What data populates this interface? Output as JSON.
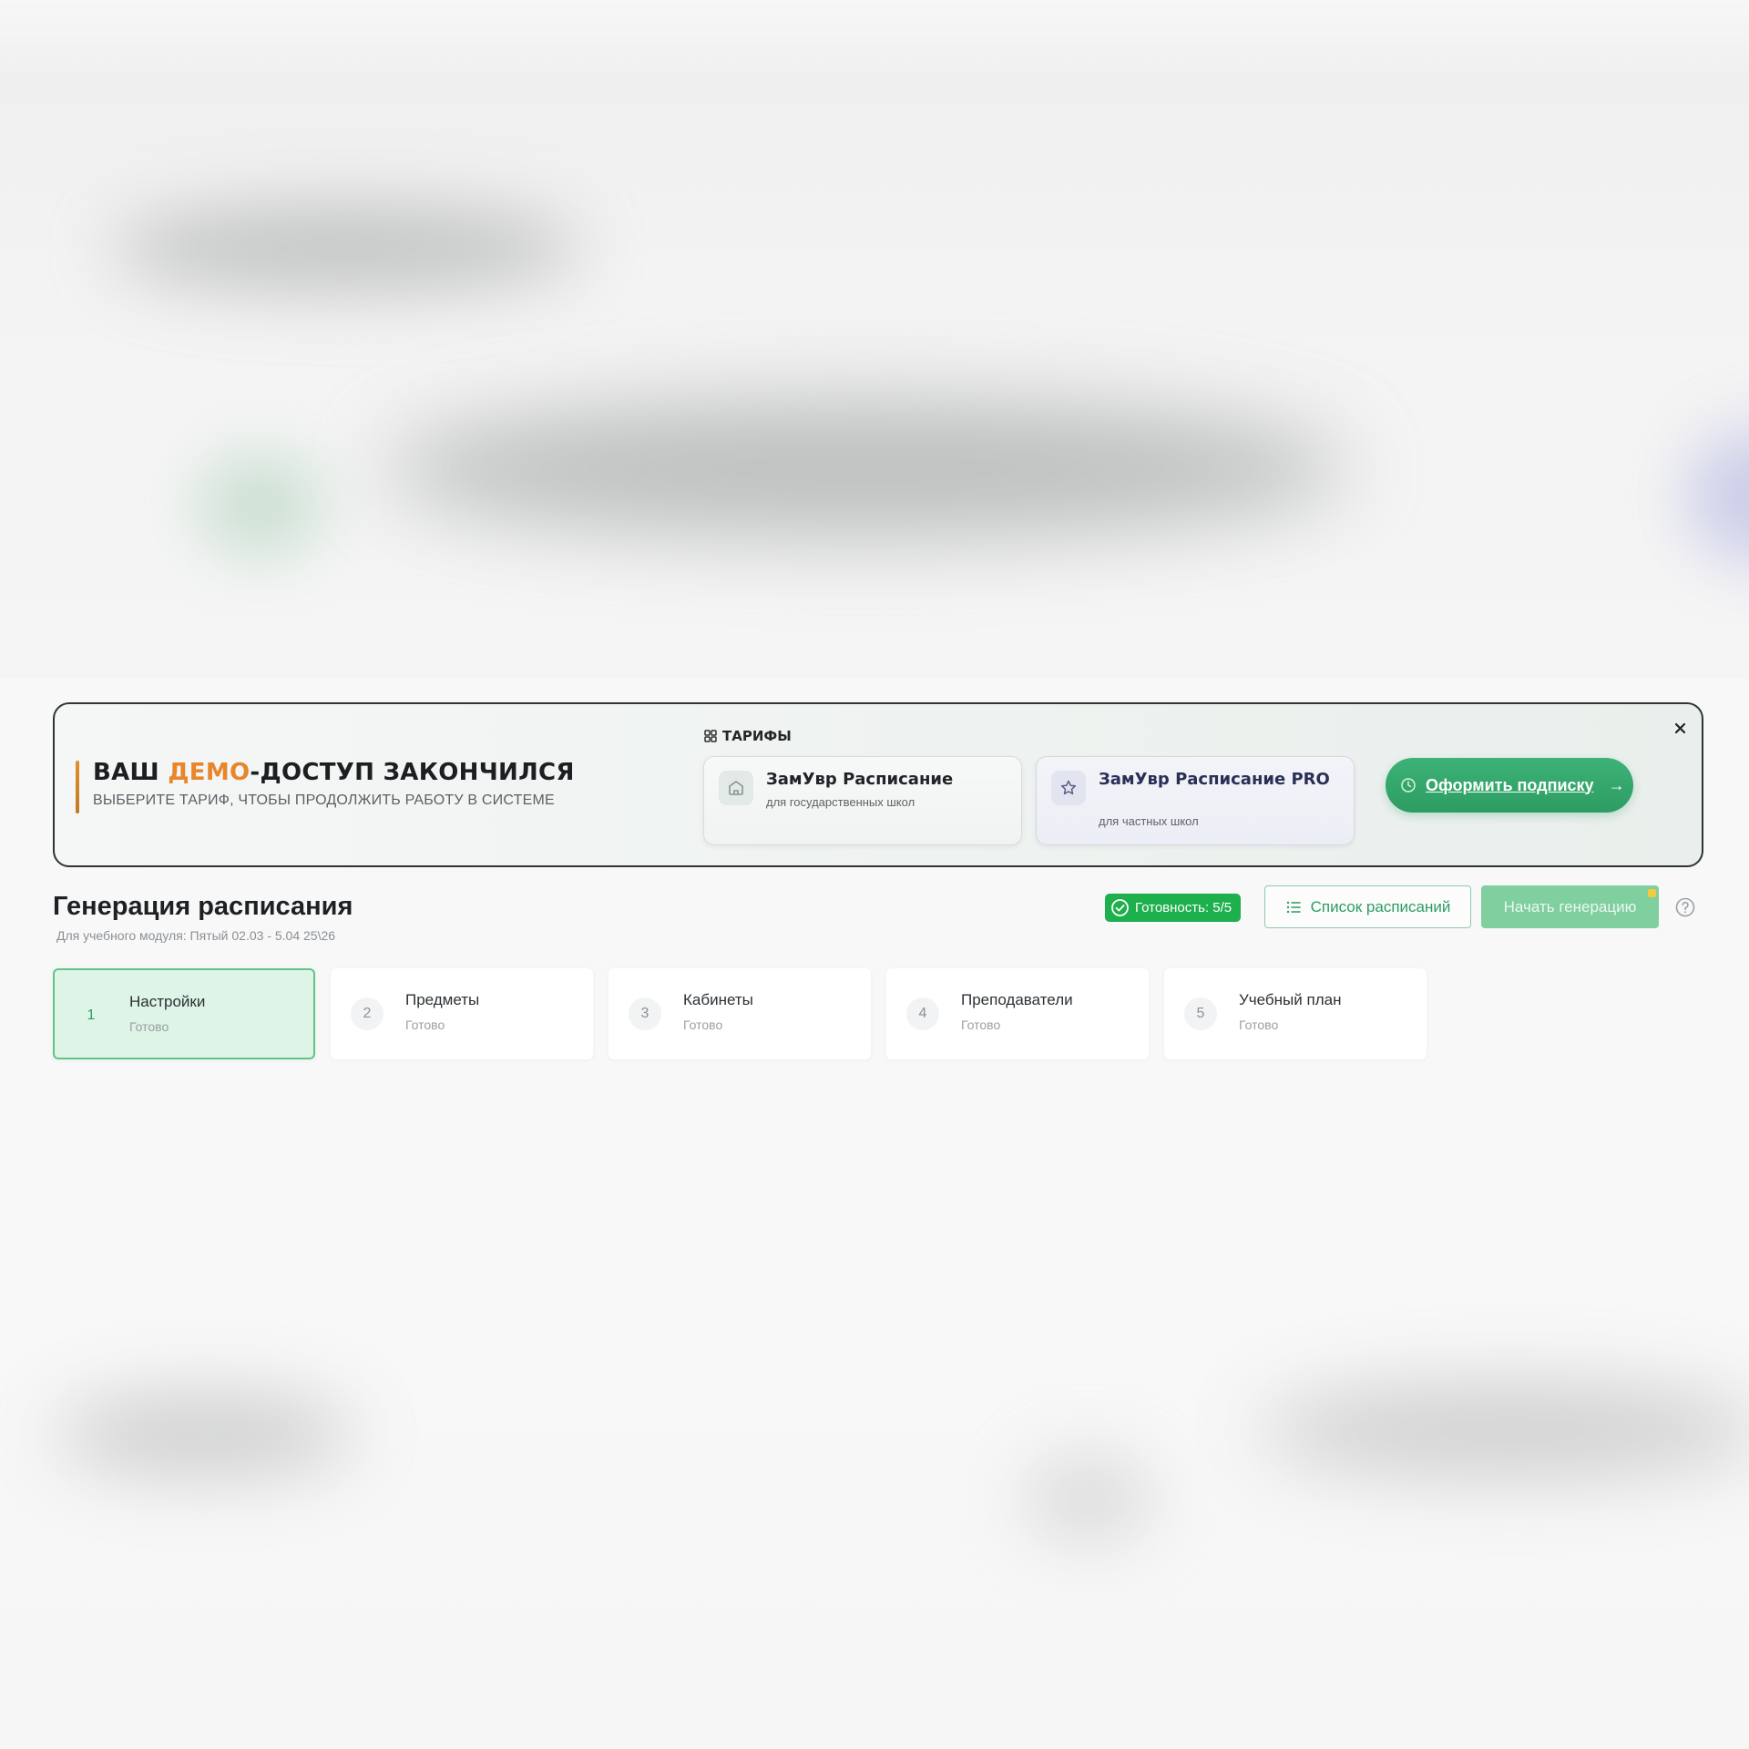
{
  "colors": {
    "brand_green": "#2d9c63",
    "badge_green": "#1eb04c",
    "highlight_orange": "#e8862b",
    "active_step_bg": "#def4e6"
  },
  "banner": {
    "title_prefix": "ВАШ ",
    "title_highlight": "ДЕМО",
    "title_suffix": "-ДОСТУП ЗАКОНЧИЛСЯ",
    "subtitle": "ВЫБЕРИТЕ ТАРИФ, ЧТОБЫ ПРОДОЛЖИТЬ РАБОТУ В СИСТЕМЕ",
    "tariffs_label": "ТАРИФЫ",
    "tariffs_icon": "grid-icon",
    "plans": [
      {
        "name": "ЗамУвр Расписание",
        "description": "для государственных школ",
        "icon": "school-icon"
      },
      {
        "name": "ЗамУвр Расписание PRO",
        "description": "для частных школ",
        "icon": "star-icon"
      }
    ],
    "subscribe_label": "Оформить подписку",
    "subscribe_icon": "clock-icon",
    "subscribe_arrow": "→",
    "close_icon": "close-icon"
  },
  "header": {
    "title": "Генерация расписания",
    "subtitle": "Для учебного модуля: Пятый 02.03 - 5.04 25\\26",
    "ready_label": "Готовность: 5/5",
    "ready_icon": "check-circle-icon",
    "list_label": "Список расписаний",
    "list_icon": "list-icon",
    "start_label": "Начать генерацию",
    "help_icon": "help-icon"
  },
  "steps": [
    {
      "number": "1",
      "title": "Настройки",
      "status": "Готово",
      "active": true
    },
    {
      "number": "2",
      "title": "Предметы",
      "status": "Готово",
      "active": false
    },
    {
      "number": "3",
      "title": "Кабинеты",
      "status": "Готово",
      "active": false
    },
    {
      "number": "4",
      "title": "Преподаватели",
      "status": "Готово",
      "active": false
    },
    {
      "number": "5",
      "title": "Учебный план",
      "status": "Готово",
      "active": false
    }
  ]
}
